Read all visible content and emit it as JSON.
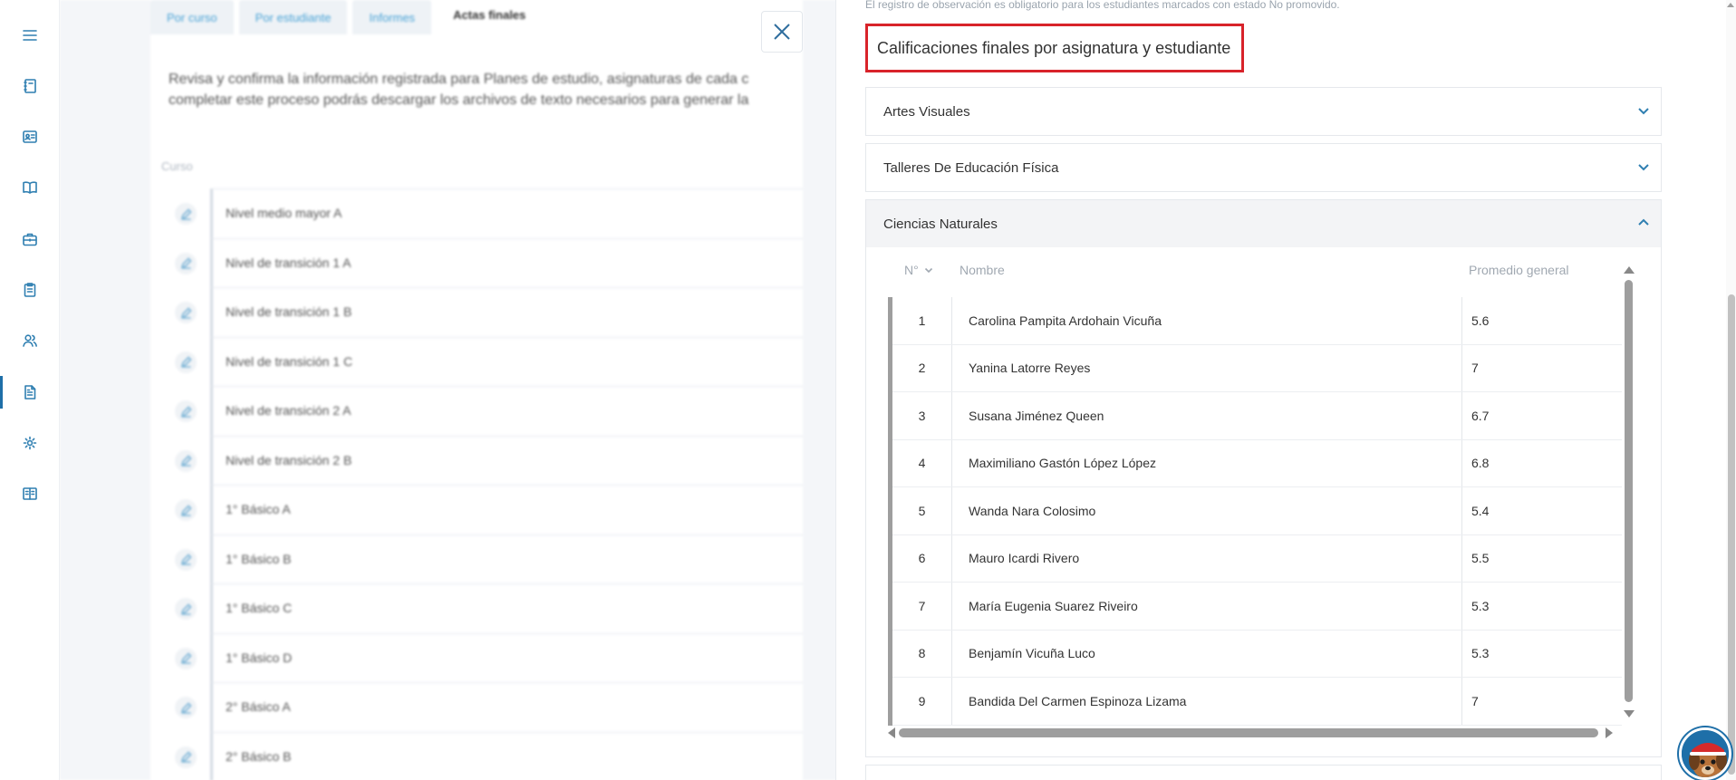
{
  "rail": {
    "items": [
      {
        "name": "menu-icon",
        "active": false
      },
      {
        "name": "notebook-icon",
        "active": false
      },
      {
        "name": "id-card-icon",
        "active": false
      },
      {
        "name": "book-open-icon",
        "active": false
      },
      {
        "name": "briefcase-icon",
        "active": false
      },
      {
        "name": "clipboard-icon",
        "active": false
      },
      {
        "name": "users-icon",
        "active": false
      },
      {
        "name": "document-icon",
        "active": true
      },
      {
        "name": "gear-icon",
        "active": false
      },
      {
        "name": "reading-book-icon",
        "active": false
      }
    ]
  },
  "background_page": {
    "tabs": [
      "Por curso",
      "Por estudiante",
      "Informes",
      "Actas finales"
    ],
    "active_tab": "Actas finales",
    "intro": "Revisa y confirma la información registrada para Planes de estudio, asignaturas de cada c\ncompletar este proceso podrás descargar los archivos de texto necesarios para generar la",
    "column_label": "Curso",
    "courses": [
      "Nivel medio mayor A",
      "Nivel de transición 1 A",
      "Nivel de transición 1 B",
      "Nivel de transición 1 C",
      "Nivel de transición 2 A",
      "Nivel de transición 2 B",
      "1° Básico A",
      "1° Básico B",
      "1° Básico C",
      "1° Básico D",
      "2° Básico A",
      "2° Básico B"
    ]
  },
  "panel": {
    "note": "El registro de observación es obligatorio para los estudiantes marcados con estado No promovido.",
    "section_title": "Calificaciones finales por asignatura y estudiante",
    "accordions": [
      {
        "label": "Artes Visuales",
        "open": false
      },
      {
        "label": "Talleres De Educación Física",
        "open": false
      },
      {
        "label": "Ciencias Naturales",
        "open": true
      }
    ],
    "table": {
      "headers": {
        "num": "N°",
        "name": "Nombre",
        "avg": "Promedio general"
      },
      "rows": [
        {
          "num": "1",
          "name": "Carolina Pampita Ardohain Vicuña",
          "avg": "5.6"
        },
        {
          "num": "2",
          "name": "Yanina Latorre Reyes",
          "avg": "7"
        },
        {
          "num": "3",
          "name": "Susana Jiménez Queen",
          "avg": "6.7"
        },
        {
          "num": "4",
          "name": "Maximiliano Gastón López López",
          "avg": "6.8"
        },
        {
          "num": "5",
          "name": "Wanda Nara Colosimo",
          "avg": "5.4"
        },
        {
          "num": "6",
          "name": "Mauro Icardi Rivero",
          "avg": "5.5"
        },
        {
          "num": "7",
          "name": "María Eugenia Suarez Riveiro",
          "avg": "5.3"
        },
        {
          "num": "8",
          "name": "Benjamín Vicuña Luco",
          "avg": "5.3"
        },
        {
          "num": "9",
          "name": "Bandida Del Carmen Espinoza Lizama",
          "avg": "7"
        }
      ]
    }
  },
  "colors": {
    "accent": "#2f7fb1",
    "highlight_border": "#d8232a",
    "open_header_bg": "#f3f4f6"
  }
}
